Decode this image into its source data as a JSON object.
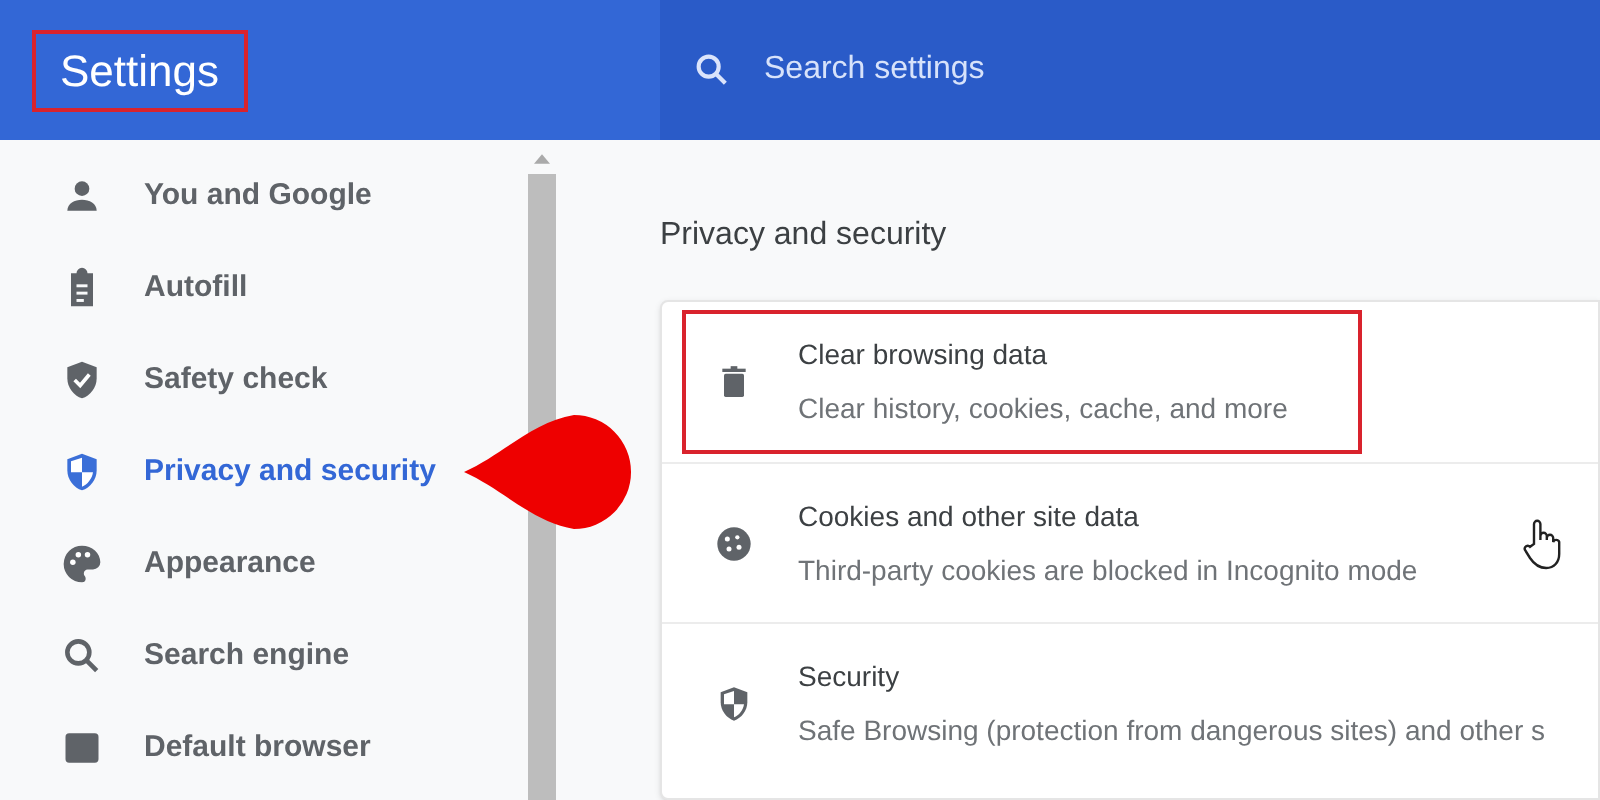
{
  "header": {
    "title": "Settings",
    "title_highlighted": true,
    "search": {
      "placeholder": "Search settings"
    }
  },
  "sidebar": {
    "items": [
      {
        "label": "You and Google",
        "selected": false,
        "pointed": false
      },
      {
        "label": "Autofill",
        "selected": false,
        "pointed": false
      },
      {
        "label": "Safety check",
        "selected": false,
        "pointed": false
      },
      {
        "label": "Privacy and security",
        "selected": true,
        "pointed": true
      },
      {
        "label": "Appearance",
        "selected": false,
        "pointed": false
      },
      {
        "label": "Search engine",
        "selected": false,
        "pointed": false
      },
      {
        "label": "Default browser",
        "selected": false,
        "pointed": false
      }
    ]
  },
  "section": {
    "title": "Privacy and security",
    "rows": [
      {
        "title": "Clear browsing data",
        "subtitle": "Clear history, cookies, cache, and more",
        "highlighted": true,
        "hovered": false
      },
      {
        "title": "Cookies and other site data",
        "subtitle": "Third-party cookies are blocked in Incognito mode",
        "highlighted": false,
        "hovered": true
      },
      {
        "title": "Security",
        "subtitle": "Safe Browsing (protection from dangerous sites) and other s",
        "highlighted": false,
        "hovered": false
      }
    ]
  }
}
